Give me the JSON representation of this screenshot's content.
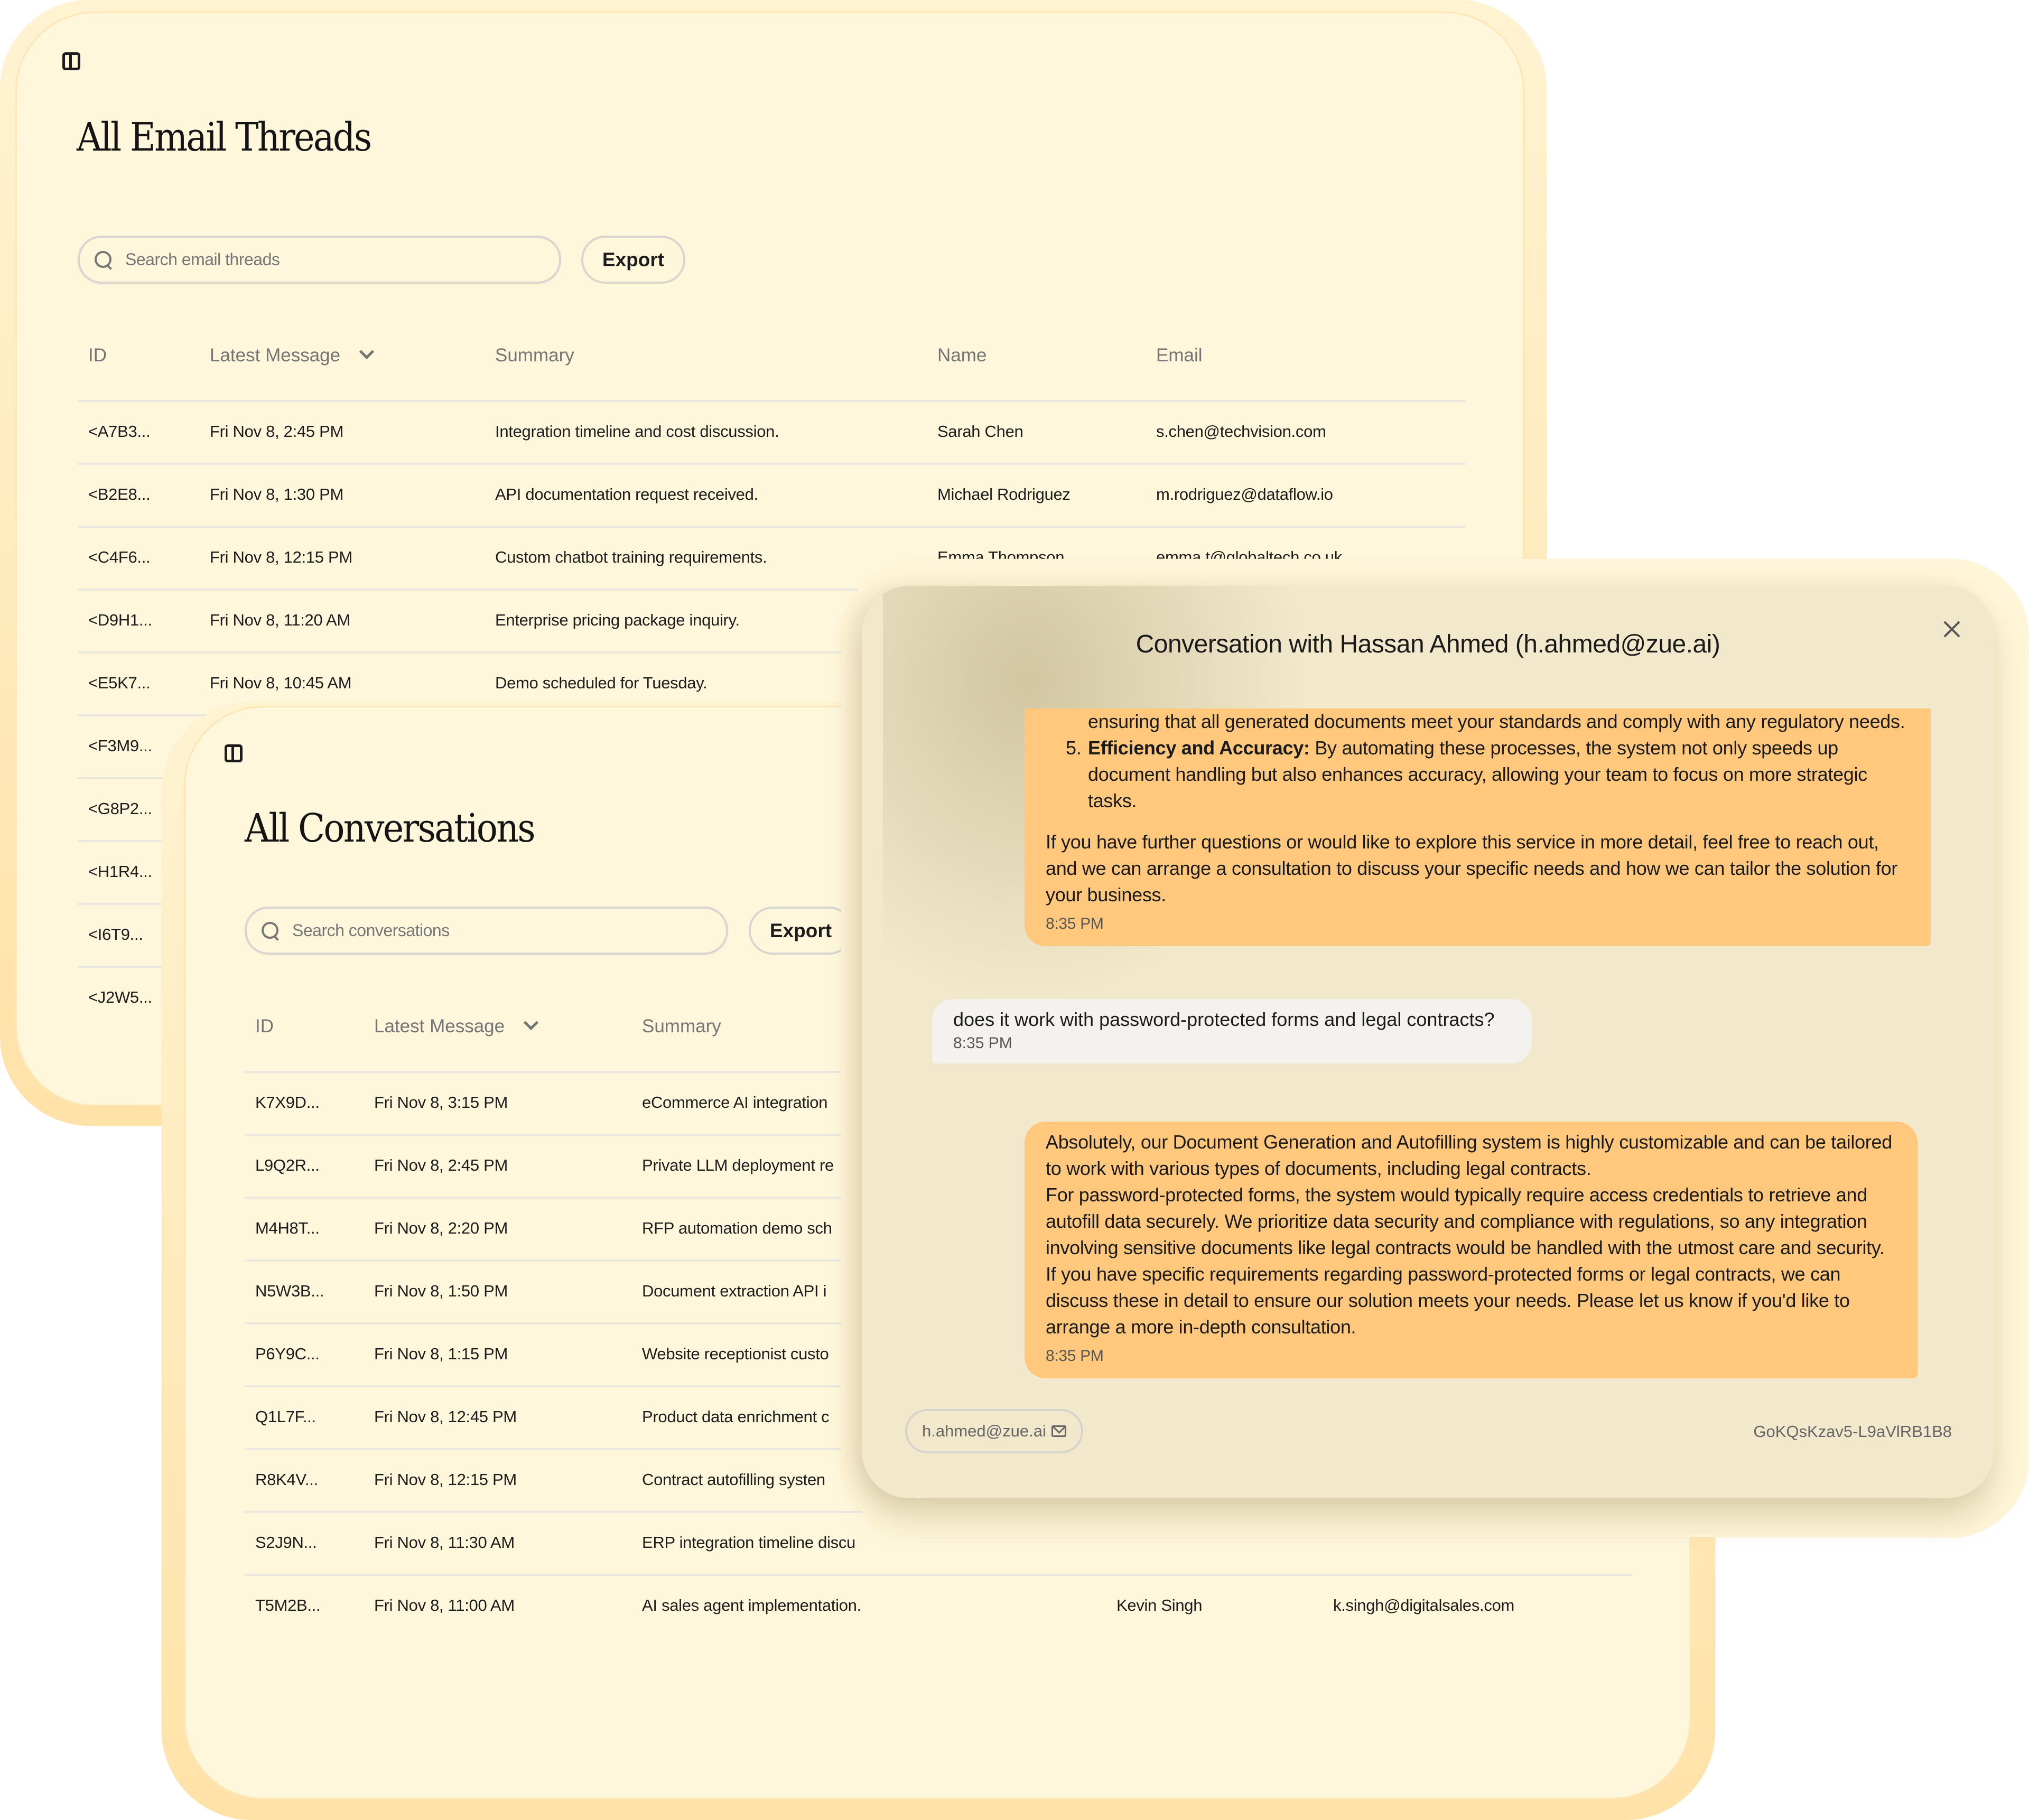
{
  "email_threads": {
    "title": "All Email Threads",
    "search": {
      "placeholder": "Search email threads",
      "value": ""
    },
    "export_label": "Export",
    "columns": [
      "ID",
      "Latest Message",
      "Summary",
      "Name",
      "Email"
    ],
    "sort_column": "Latest Message",
    "rows": [
      {
        "id": "<A7B3...",
        "latest": "Fri Nov 8, 2:45 PM",
        "summary": "Integration timeline and cost discussion.",
        "name": "Sarah Chen",
        "email": "s.chen@techvision.com"
      },
      {
        "id": "<B2E8...",
        "latest": "Fri Nov 8, 1:30 PM",
        "summary": "API documentation request received.",
        "name": "Michael Rodriguez",
        "email": "m.rodriguez@dataflow.io"
      },
      {
        "id": "<C4F6...",
        "latest": "Fri Nov 8, 12:15 PM",
        "summary": "Custom chatbot training requirements.",
        "name": "Emma Thompson",
        "email": "emma.t@globaltech.co.uk"
      },
      {
        "id": "<D9H1...",
        "latest": "Fri Nov 8, 11:20 AM",
        "summary": "Enterprise pricing package inquiry.",
        "name": "",
        "email": ""
      },
      {
        "id": "<E5K7...",
        "latest": "Fri Nov 8, 10:45 AM",
        "summary": "Demo scheduled for Tuesday.",
        "name": "",
        "email": ""
      },
      {
        "id": "<F3M9...",
        "latest": "",
        "summary": "",
        "name": "",
        "email": ""
      },
      {
        "id": "<G8P2...",
        "latest": "",
        "summary": "",
        "name": "",
        "email": ""
      },
      {
        "id": "<H1R4...",
        "latest": "",
        "summary": "",
        "name": "",
        "email": ""
      },
      {
        "id": "<I6T9...",
        "latest": "",
        "summary": "",
        "name": "",
        "email": ""
      },
      {
        "id": "<J2W5...",
        "latest": "",
        "summary": "",
        "name": "",
        "email": ""
      }
    ]
  },
  "conversations": {
    "title": "All Conversations",
    "search": {
      "placeholder": "Search conversations",
      "value": ""
    },
    "export_label": "Export",
    "columns": [
      "ID",
      "Latest Message",
      "Summary"
    ],
    "sort_column": "Latest Message",
    "rows": [
      {
        "id": "K7X9D...",
        "latest": "Fri Nov 8, 3:15 PM",
        "summary": "eCommerce AI integration",
        "name": "",
        "email": ""
      },
      {
        "id": "L9Q2R...",
        "latest": "Fri Nov 8, 2:45 PM",
        "summary": "Private LLM deployment re",
        "name": "",
        "email": ""
      },
      {
        "id": "M4H8T...",
        "latest": "Fri Nov 8, 2:20 PM",
        "summary": "RFP automation demo sch",
        "name": "",
        "email": ""
      },
      {
        "id": "N5W3B...",
        "latest": "Fri Nov 8, 1:50 PM",
        "summary": "Document extraction API i",
        "name": "",
        "email": ""
      },
      {
        "id": "P6Y9C...",
        "latest": "Fri Nov 8, 1:15 PM",
        "summary": "Website receptionist custo",
        "name": "",
        "email": ""
      },
      {
        "id": "Q1L7F...",
        "latest": "Fri Nov 8, 12:45 PM",
        "summary": "Product data enrichment c",
        "name": "",
        "email": ""
      },
      {
        "id": "R8K4V...",
        "latest": "Fri Nov 8, 12:15 PM",
        "summary": "Contract autofilling systen",
        "name": "",
        "email": ""
      },
      {
        "id": "S2J9N...",
        "latest": "Fri Nov 8, 11:30 AM",
        "summary": "ERP integration timeline discu",
        "name": "",
        "email": ""
      },
      {
        "id": "T5M2B...",
        "latest": "Fri Nov 8, 11:00 AM",
        "summary": "AI sales agent implementation.",
        "name": "Kevin Singh",
        "email": "k.singh@digitalsales.com"
      }
    ]
  },
  "modal": {
    "title": "Conversation with Hassan Ahmed (h.ahmed@zue.ai)",
    "messages": [
      {
        "role": "agent",
        "partial_item_tail": "ensuring that all generated documents meet your standards and comply with any regulatory needs.",
        "list_item": {
          "number": "5.",
          "bold": "Efficiency and Accuracy:",
          "text": " By automating these processes, the system not only speeds up document handling but also enhances accuracy, allowing your team to focus on more strategic tasks."
        },
        "paragraph": "If you have further questions or would like to explore this service in more detail, feel free to reach out, and we can arrange a consultation to discuss your specific needs and how we can tailor the solution for your business.",
        "time": "8:35 PM"
      },
      {
        "role": "user",
        "text": "does it work with password-protected forms and legal contracts?",
        "time": "8:35 PM"
      },
      {
        "role": "agent",
        "lines": [
          "Absolutely, our Document Generation and Autofilling system is highly customizable and can be tailored to work with various types of documents, including legal contracts.",
          "For password-protected forms, the system would typically require access credentials to retrieve and autofill data securely. We prioritize data security and compliance with regulations, so any integration involving sensitive documents like legal contracts would be handled with the utmost care and security.",
          "If you have specific requirements regarding password-protected forms or legal contracts, we can discuss these in detail to ensure our solution meets your needs. Please let us know if you'd like to arrange a more in-depth consultation."
        ],
        "time": "8:35 PM"
      }
    ],
    "footer": {
      "email_chip": "h.ahmed@zue.ai",
      "conversation_id": "GoKQsKzav5-L9aVlRB1B8"
    }
  },
  "colors": {
    "card_bg": "#fff7dc",
    "card_rim": "#ffe2a8",
    "modal_bg": "#f2e9cd",
    "agent_bubble": "#ffc87d",
    "user_bubble": "#f4f2ee",
    "text_primary": "#1c1c1c",
    "text_muted": "#757575"
  }
}
